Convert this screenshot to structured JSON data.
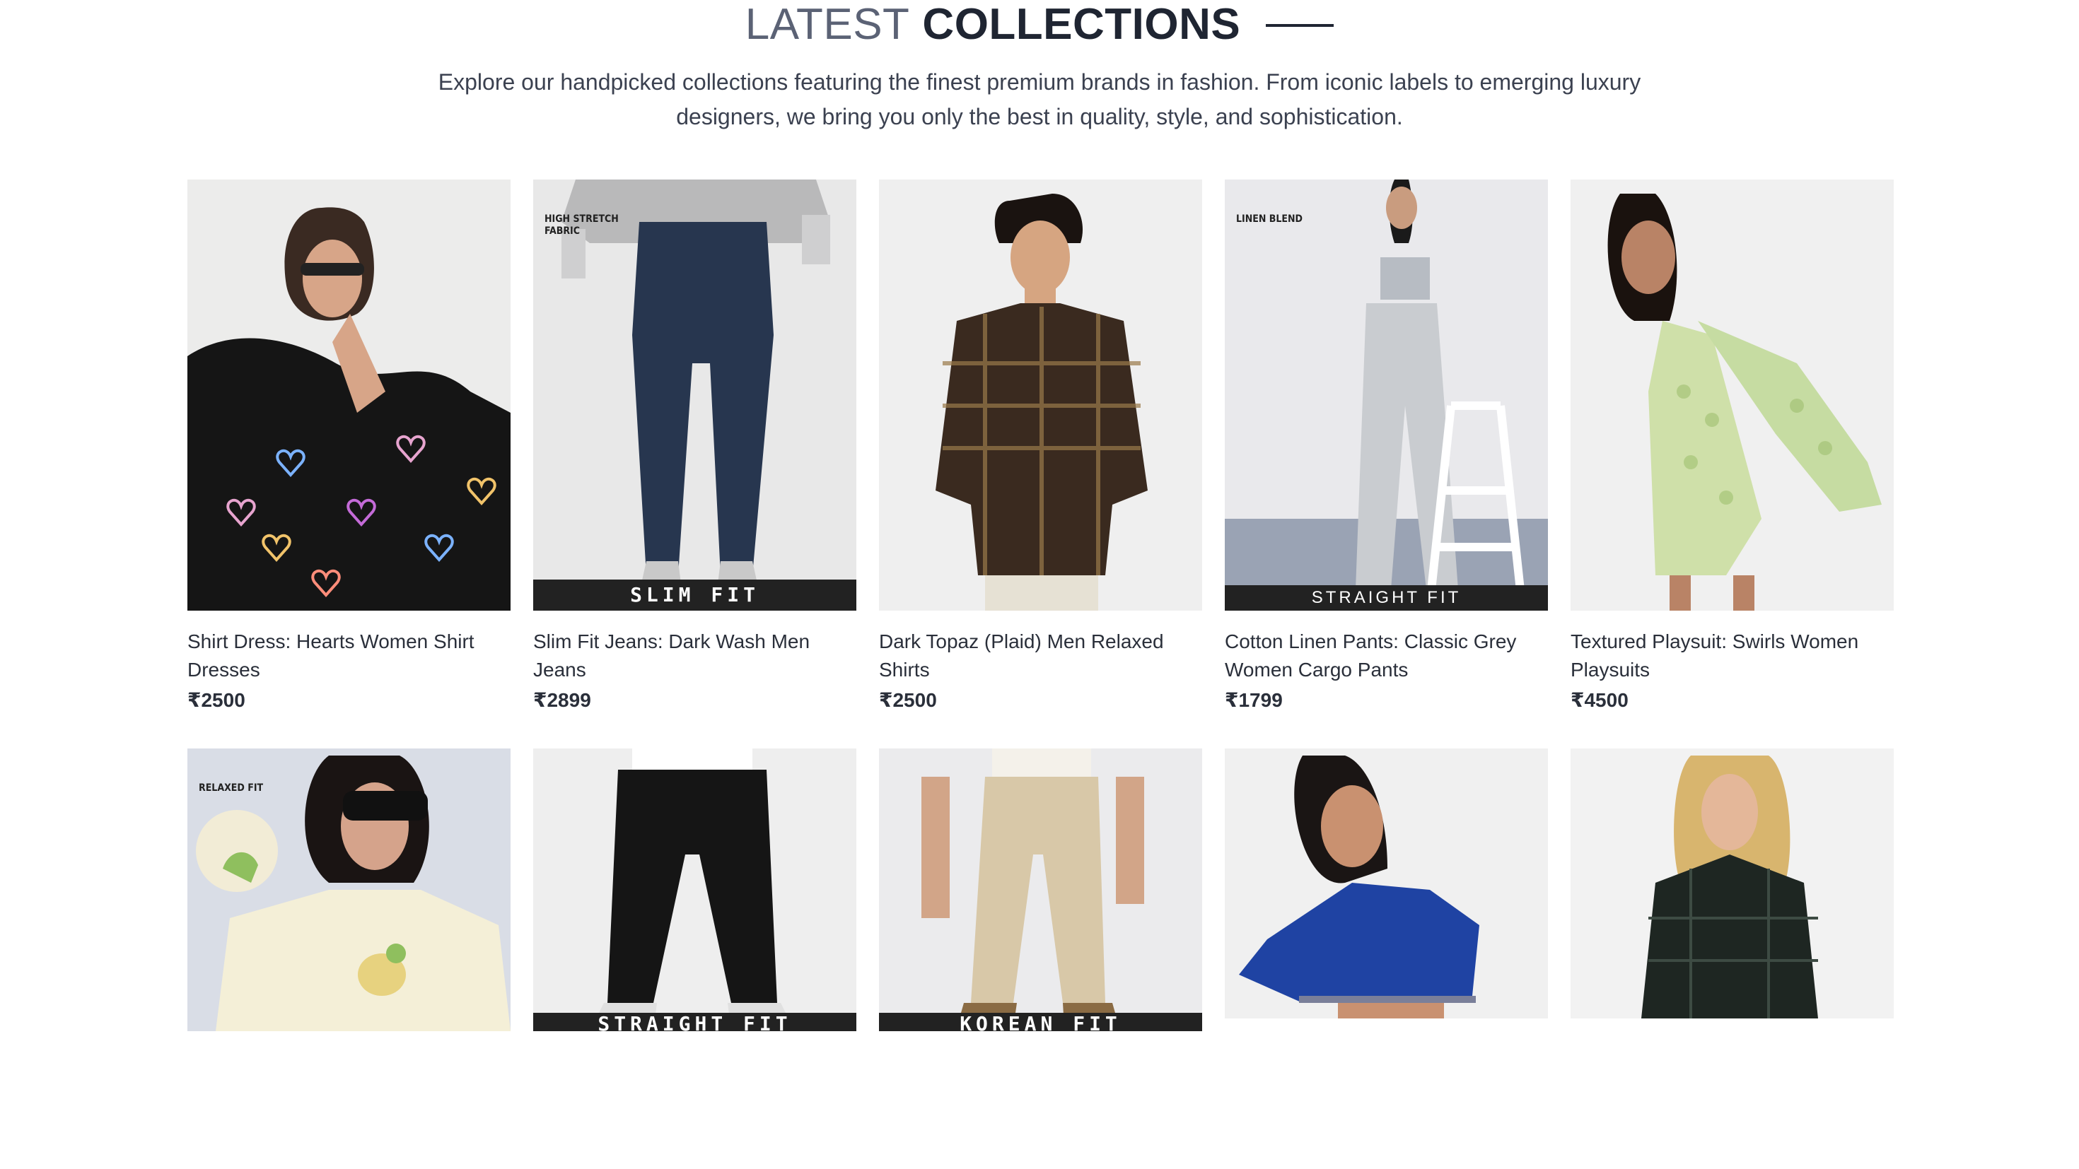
{
  "section": {
    "heading_light": "LATEST",
    "heading_bold": "COLLECTIONS",
    "intro": "Explore our handpicked collections featuring the finest premium brands in fashion. From iconic labels to emerging luxury designers, we bring you only the best in quality, style, and sophistication."
  },
  "products": [
    {
      "title": "Shirt Dress: Hearts Women Shirt Dresses",
      "price": "₹2500",
      "tag": "",
      "band": "",
      "image": "woman-in-black-heart-print-shirt-dress"
    },
    {
      "title": "Slim Fit Jeans: Dark Wash Men Jeans",
      "price": "₹2899",
      "tag": "HIGH STRETCH FABRIC",
      "band": "SLIM FIT",
      "image": "dark-wash-slim-jeans"
    },
    {
      "title": "Dark Topaz (Plaid) Men Relaxed Shirts",
      "price": "₹2500",
      "tag": "",
      "band": "",
      "image": "man-in-brown-plaid-shirt"
    },
    {
      "title": "Cotton Linen Pants: Classic Grey Women Cargo Pants",
      "price": "₹1799",
      "tag": "LINEN BLEND",
      "band": "STRAIGHT FIT",
      "image": "woman-in-grey-cargo-pants"
    },
    {
      "title": "Textured Playsuit: Swirls Women Playsuits",
      "price": "₹4500",
      "tag": "",
      "band": "",
      "image": "woman-in-green-checked-playsuit"
    },
    {
      "title": "",
      "price": "",
      "tag": "RELAXED FIT",
      "band": "",
      "image": "woman-in-cream-duck-embroidered-tee"
    },
    {
      "title": "",
      "price": "",
      "tag": "",
      "band": "STRAIGHT FIT",
      "image": "black-straight-jeans"
    },
    {
      "title": "",
      "price": "",
      "tag": "",
      "band": "KOREAN FIT",
      "image": "beige-korean-fit-trousers"
    },
    {
      "title": "",
      "price": "",
      "tag": "",
      "band": "",
      "image": "woman-in-blue-crop-top"
    },
    {
      "title": "",
      "price": "",
      "tag": "",
      "band": "",
      "image": "woman-in-dark-check-ruffle-blouse"
    }
  ]
}
